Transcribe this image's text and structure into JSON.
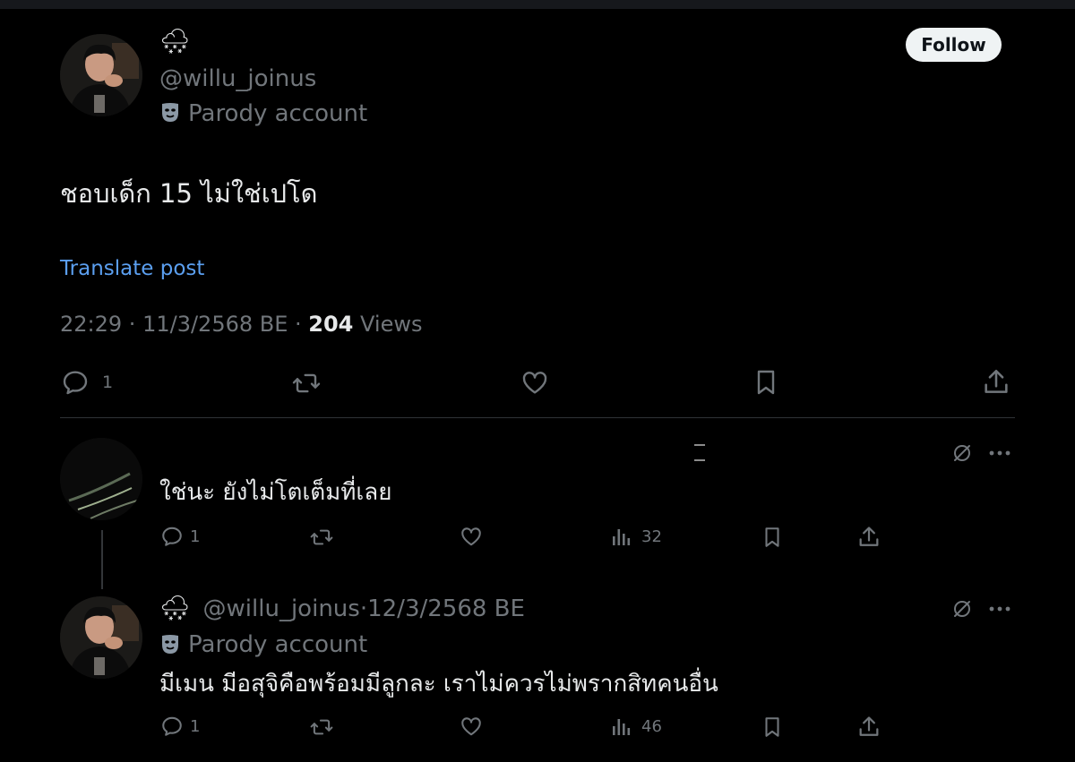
{
  "main_post": {
    "display_name_emoji": "🌨",
    "handle": "@willu_joinus",
    "parody_label": "Parody account",
    "follow_label": "Follow",
    "text": "ชอบเด็ก 15 ไม่ใช่เปโด",
    "translate_label": "Translate post",
    "time": "22:29",
    "date": "11/3/2568 BE",
    "views_count": "204",
    "views_label": "Views",
    "reply_count": "1"
  },
  "replies": [
    {
      "text": "ใช่นะ ยังไม่โตเต็มที่เลย",
      "reply_count": "1",
      "views_count": "32"
    },
    {
      "display_name_emoji": "🌨",
      "handle": "@willu_joinus",
      "date": "12/3/2568 BE",
      "parody_label": "Parody account",
      "text": "มีเมน มีอสุจิคือพร้อมมีลูกละ เราไม่ควรไม่พรากสิทคนอื่น",
      "reply_count": "1",
      "views_count": "46"
    }
  ],
  "icons": {
    "reply": "reply-icon",
    "repost": "repost-icon",
    "like": "like-icon",
    "bookmark": "bookmark-icon",
    "share": "share-icon",
    "views": "views-icon",
    "grok": "grok-icon",
    "more": "more-icon",
    "parody": "parody-mask-icon"
  },
  "colors": {
    "background": "#000000",
    "text": "#e7e9ea",
    "muted": "#71767b",
    "link": "#1d9bf0",
    "follow_bg": "#eff3f4"
  }
}
